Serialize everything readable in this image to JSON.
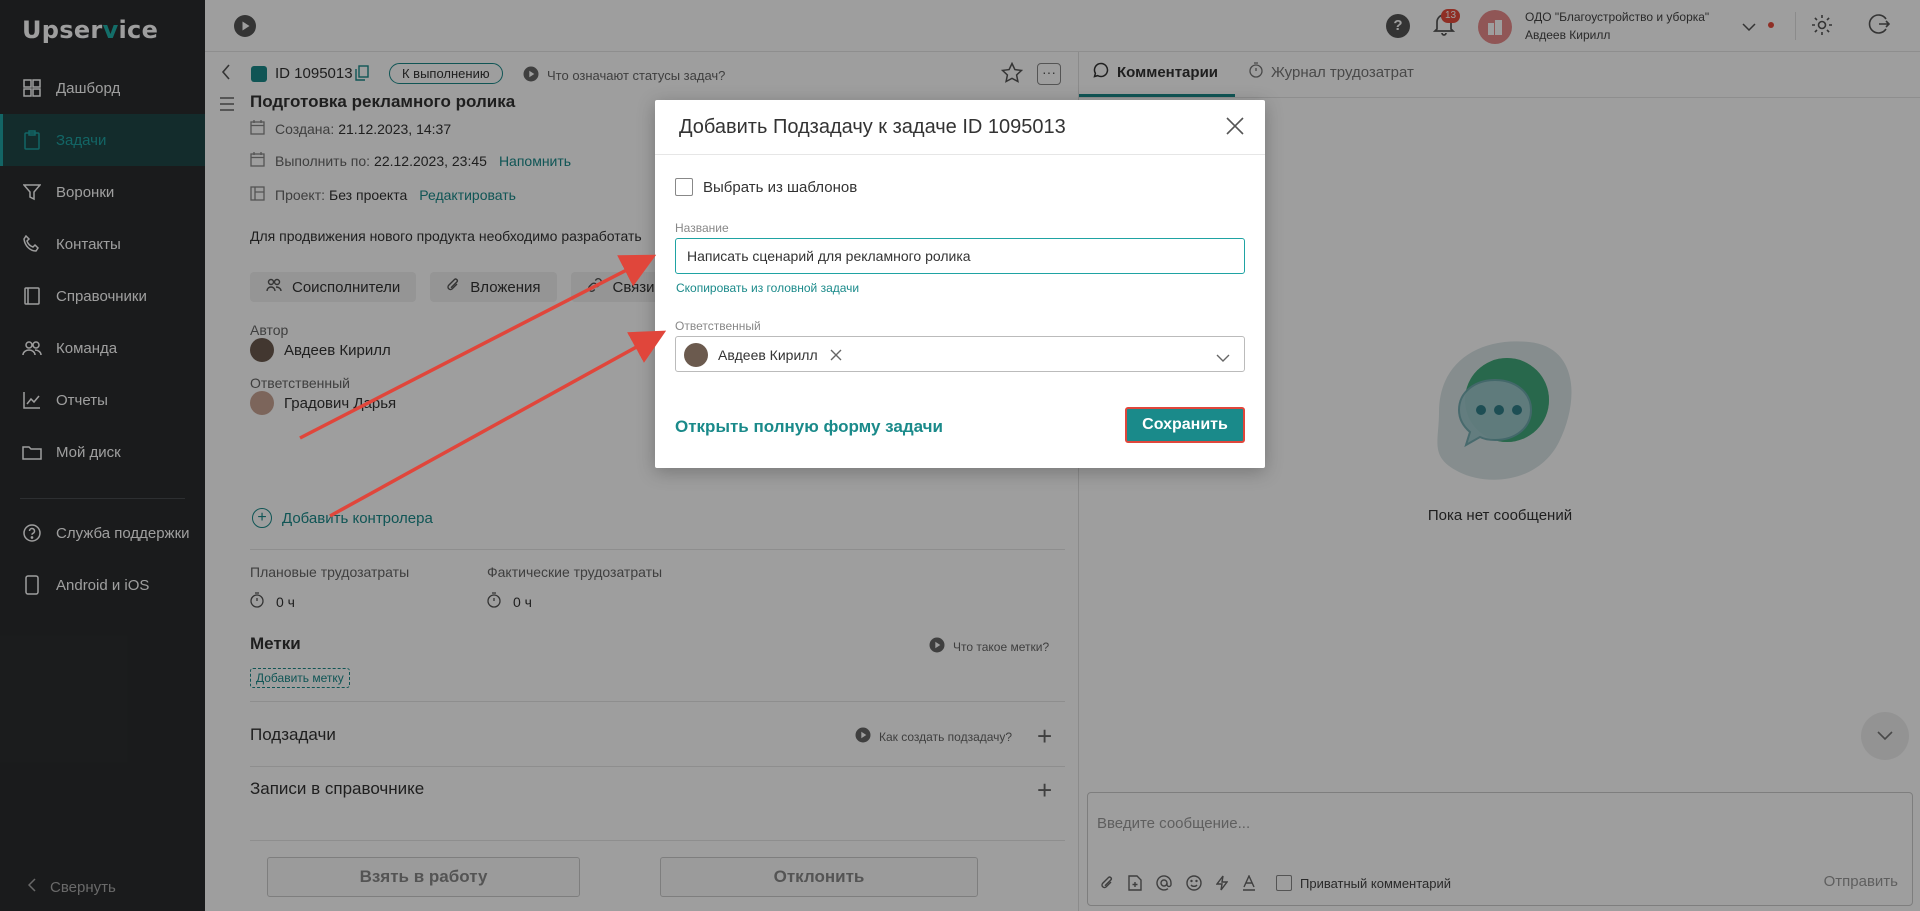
{
  "sidebar": {
    "logo_pre": "Upser",
    "logo_acc": "v",
    "logo_post": "ice",
    "items": [
      {
        "label": "Дашборд",
        "icon": "dashboard-icon"
      },
      {
        "label": "Задачи",
        "icon": "tasks-icon",
        "active": true
      },
      {
        "label": "Воронки",
        "icon": "funnel-icon"
      },
      {
        "label": "Контакты",
        "icon": "contacts-icon"
      },
      {
        "label": "Справочники",
        "icon": "book-icon"
      },
      {
        "label": "Команда",
        "icon": "team-icon"
      },
      {
        "label": "Отчеты",
        "icon": "chart-icon"
      },
      {
        "label": "Мой диск",
        "icon": "folder-icon"
      }
    ],
    "support_items": [
      {
        "label": "Служба поддержки",
        "icon": "help-circle-icon"
      },
      {
        "label": "Android и iOS",
        "icon": "phone-icon"
      }
    ],
    "collapse_label": "Свернуть"
  },
  "topbar": {
    "help_label": "?",
    "notifications_count": "13",
    "org_name": "ОДО \"Благоустройство и уборка\"",
    "user_name": "Авдеев Кирилл"
  },
  "task": {
    "id_label": "ID 1095013",
    "status": "К выполнению",
    "status_help": "Что означают статусы задач?",
    "title": "Подготовка рекламного ролика",
    "created_label": "Создана:",
    "created_value": "21.12.2023, 14:37",
    "due_label": "Выполнить по:",
    "due_value": "22.12.2023, 23:45",
    "remind_link": "Напомнить",
    "project_label": "Проект:",
    "project_value": "Без проекта",
    "edit_link": "Редактировать",
    "description": "Для продвижения нового продукта необходимо разработать",
    "tabs": [
      "Соисполнители",
      "Вложения",
      "Связи"
    ],
    "author_label": "Автор",
    "author_name": "Авдеев Кирилл",
    "assignee_label": "Ответственный",
    "assignee_name": "Градович Дарья",
    "add_controller": "Добавить контролера",
    "planned_label": "Плановые трудозатраты",
    "planned_value": "0 ч",
    "actual_label": "Фактические трудозатраты",
    "actual_value": "0 ч",
    "tags_title": "Метки",
    "tags_help": "Что такое метки?",
    "add_tag": "Добавить метку",
    "subtasks_title": "Подзадачи",
    "subtasks_help": "Как создать подзадачу?",
    "records_title": "Записи в справочнике",
    "take_button": "Взять в работу",
    "reject_button": "Отклонить"
  },
  "right_panel": {
    "tab_comments": "Комментарии",
    "tab_journal": "Журнал трудозатрат",
    "empty_text": "Пока нет сообщений",
    "message_placeholder": "Введите сообщение...",
    "private_label": "Приватный комментарий",
    "send_label": "Отправить"
  },
  "modal": {
    "title": "Добавить Подзадачу к задаче ID 1095013",
    "template_label": "Выбрать из шаблонов",
    "name_label": "Название",
    "name_value": "Написать сценарий для рекламного ролика",
    "copy_link": "Скопировать из головной задачи",
    "assignee_label": "Ответственный",
    "assignee_value": "Авдеев Кирилл",
    "open_full": "Открыть полную форму задачи",
    "save_label": "Сохранить"
  },
  "colors": {
    "accent": "#1a8a8a",
    "sidebar_bg": "#2b2d2e",
    "annotation_arrow": "#e0463b"
  }
}
